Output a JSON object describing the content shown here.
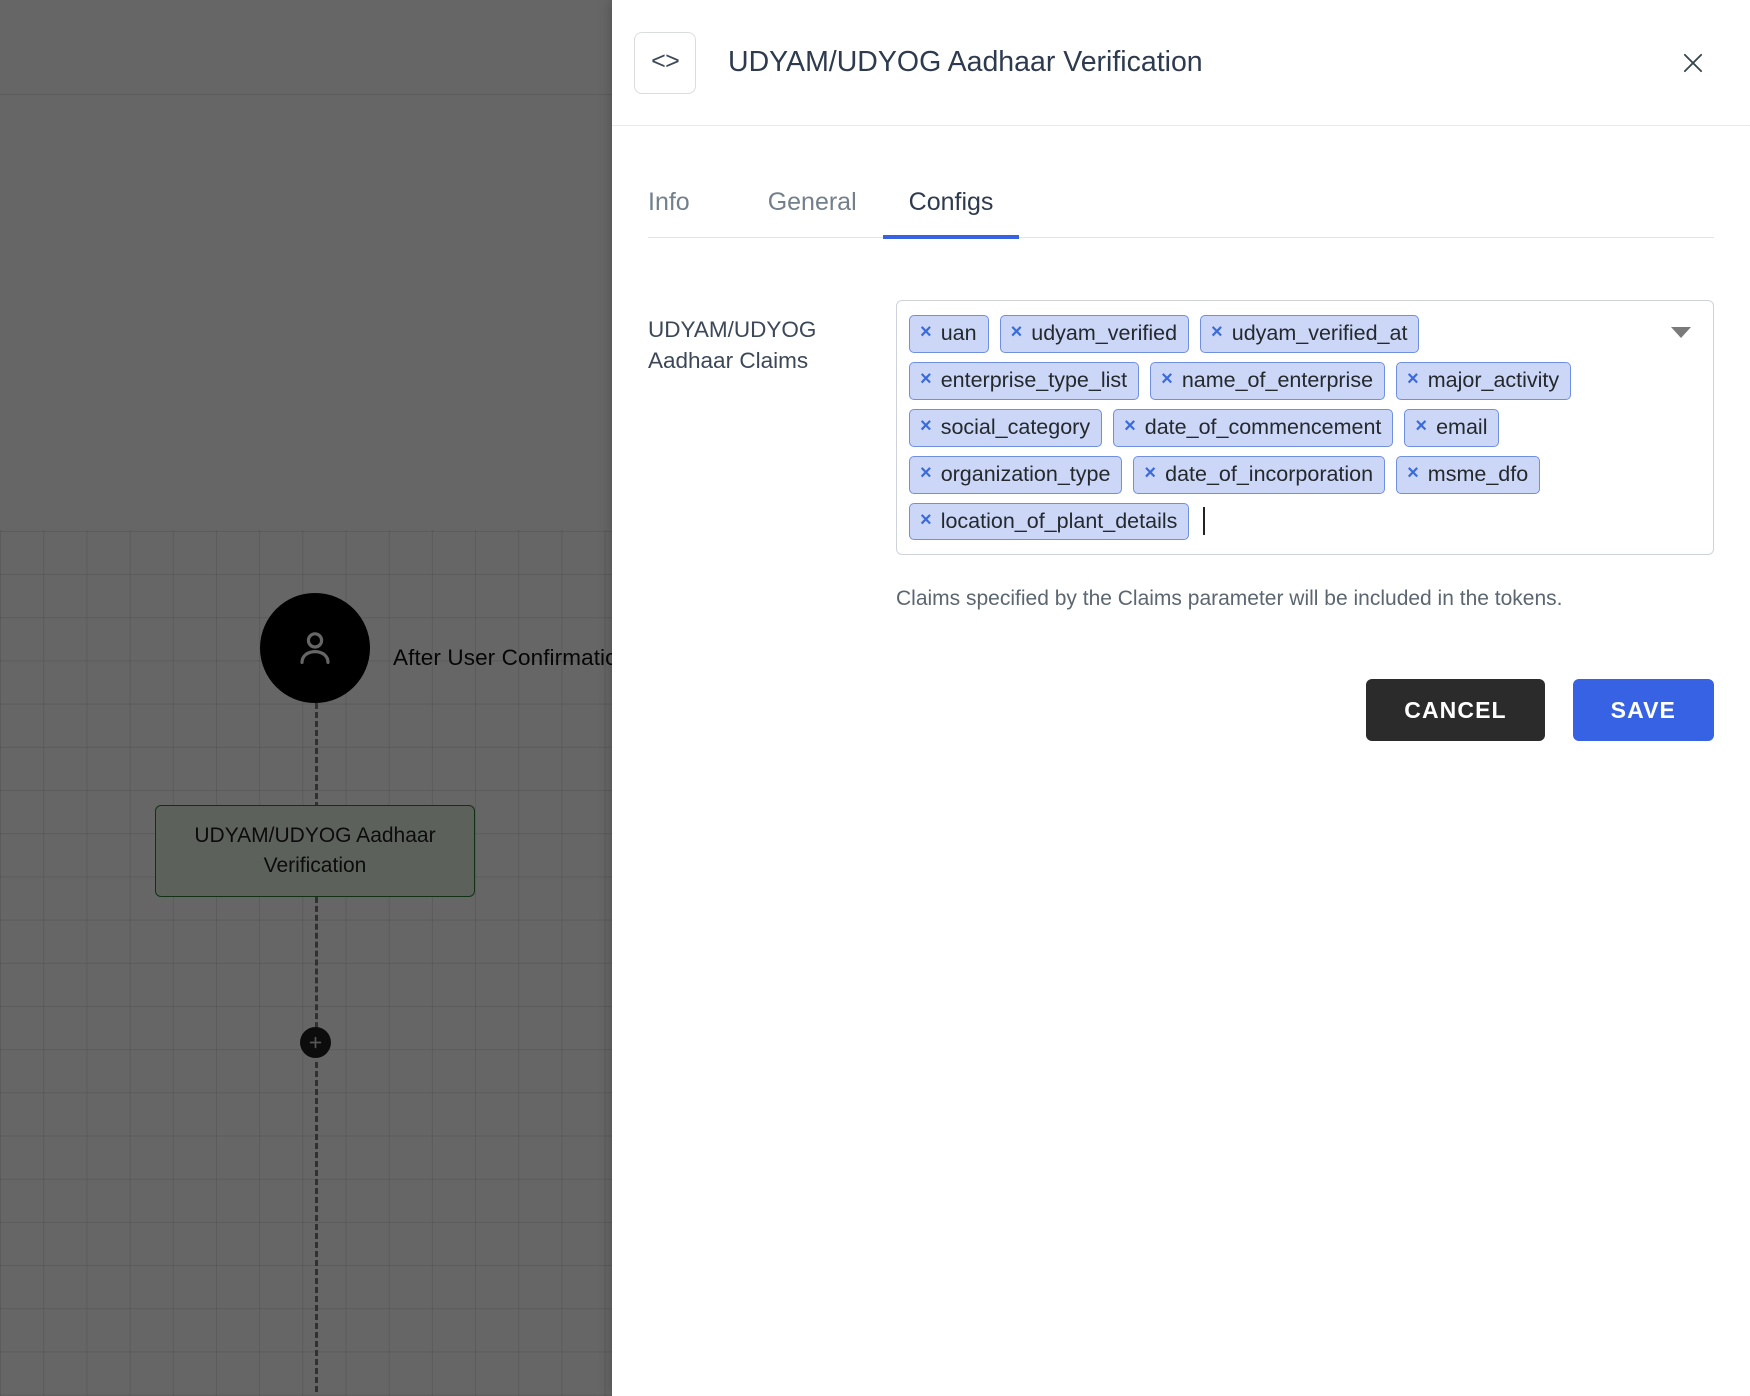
{
  "canvas": {
    "user_node_icon": "person-icon",
    "edge_label": "After User Confirmation",
    "node_label": "UDYAM/UDYOG Aadhaar Verification",
    "add_button_icon": "plus-icon"
  },
  "drawer": {
    "code_icon_label": "<>",
    "title": "UDYAM/UDYOG Aadhaar Verification",
    "close_icon": "close-icon",
    "tabs": [
      {
        "label": "Info",
        "active": false
      },
      {
        "label": "General",
        "active": false
      },
      {
        "label": "Configs",
        "active": true
      }
    ],
    "field": {
      "label": "UDYAM/UDYOG Aadhaar Claims",
      "hint": "Claims specified by the Claims parameter will be included in the tokens.",
      "dropdown_icon": "chevron-down-icon",
      "chips": [
        "uan",
        "udyam_verified",
        "udyam_verified_at",
        "enterprise_type_list",
        "name_of_enterprise",
        "major_activity",
        "social_category",
        "date_of_commencement",
        "email",
        "organization_type",
        "date_of_incorporation",
        "msme_dfo",
        "location_of_plant_details"
      ],
      "chip_remove_glyph": "×"
    },
    "actions": {
      "cancel_label": "CANCEL",
      "save_label": "SAVE"
    }
  },
  "colors": {
    "accent": "#3662e3",
    "chip_bg": "#ccd7f7",
    "chip_border": "#6f8fe0",
    "chip_x": "#3b6bdb",
    "cancel_bg": "#2b2b2b",
    "node_border": "#2f7d32",
    "node_bg": "#e8f2e6",
    "scrim": "rgba(0,0,0,0.60)"
  }
}
